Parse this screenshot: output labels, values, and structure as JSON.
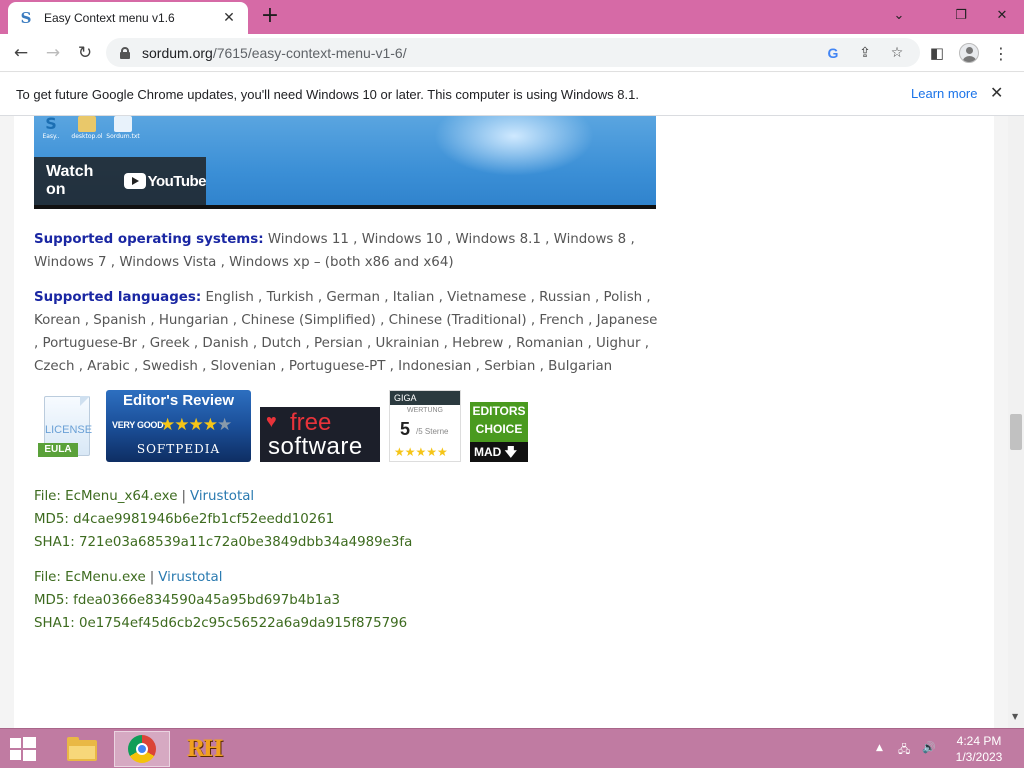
{
  "browser": {
    "tab_title": "Easy Context menu v1.6",
    "tab_favicon": "S",
    "url_host": "sordum.org",
    "url_path": "/7615/easy-context-menu-v1-6/",
    "window_colors": {
      "frame": "#d66aa6"
    }
  },
  "infobar": {
    "message": "To get future Google Chrome updates, you'll need Windows 10 or later. This computer is using Windows 8.1.",
    "learn_more": "Learn more"
  },
  "video": {
    "watch_label": "Watch on",
    "youtube_label": "YouTube",
    "desktop_icon_labels": [
      "Easy..",
      "desktop.ol",
      "Sordum.txt"
    ]
  },
  "content": {
    "os_label": "Supported operating systems:",
    "os_list": "Windows 11 , Windows 10 , Windows 8.1 , Windows 8 , Windows 7 , Windows Vista , Windows xp – (both x86 and x64)",
    "lang_label": "Supported languages:",
    "lang_list": "English , Turkish , German , Italian , Vietnamese , Russian , Polish , Korean , Spanish , Hungarian , Chinese (Simplified) , Chinese (Traditional) , French , Japanese , Portuguese-Br , Greek , Danish , Dutch , Persian , Ukrainian , Hebrew , Romanian , Uighur , Czech , Arabic , Swedish , Slovenian , Portuguese-PT , Indonesian , Serbian , Bulgarian"
  },
  "badges": {
    "license": {
      "top": "LICENSE",
      "bottom": "EULA"
    },
    "softpedia": {
      "heading": "Editor's Review",
      "rating_text": "VERY GOOD",
      "brand": "SOFTPEDIA",
      "stars": 4,
      "max_stars": 5
    },
    "ilovefree": {
      "line1": "free",
      "line2": "software"
    },
    "giga": {
      "brand": "GIGA",
      "subtitle": "WERTUNG",
      "score": "5",
      "score_unit": "/5 Sterne",
      "stars": 5
    },
    "mad": {
      "line1": "EDITORS",
      "line2": "CHOICE",
      "brand": "MAD"
    }
  },
  "files": [
    {
      "file_label": "File: EcMenu_x64.exe",
      "separator": "|",
      "virustotal": "Virustotal",
      "md5": "MD5: d4cae9981946b6e2fb1cf52eedd10261",
      "sha1": "SHA1: 721e03a68539a11c72a0be3849dbb34a4989e3fa"
    },
    {
      "file_label": "File: EcMenu.exe",
      "separator": "|",
      "virustotal": "Virustotal",
      "md5": "MD5: fdea0366e834590a45a95bd697b4b1a3",
      "sha1": "SHA1: 0e1754ef45d6cb2c95c56522a6a9da915f875796"
    }
  ],
  "taskbar": {
    "rh_label": "RH",
    "time": "4:24 PM",
    "date": "1/3/2023"
  }
}
